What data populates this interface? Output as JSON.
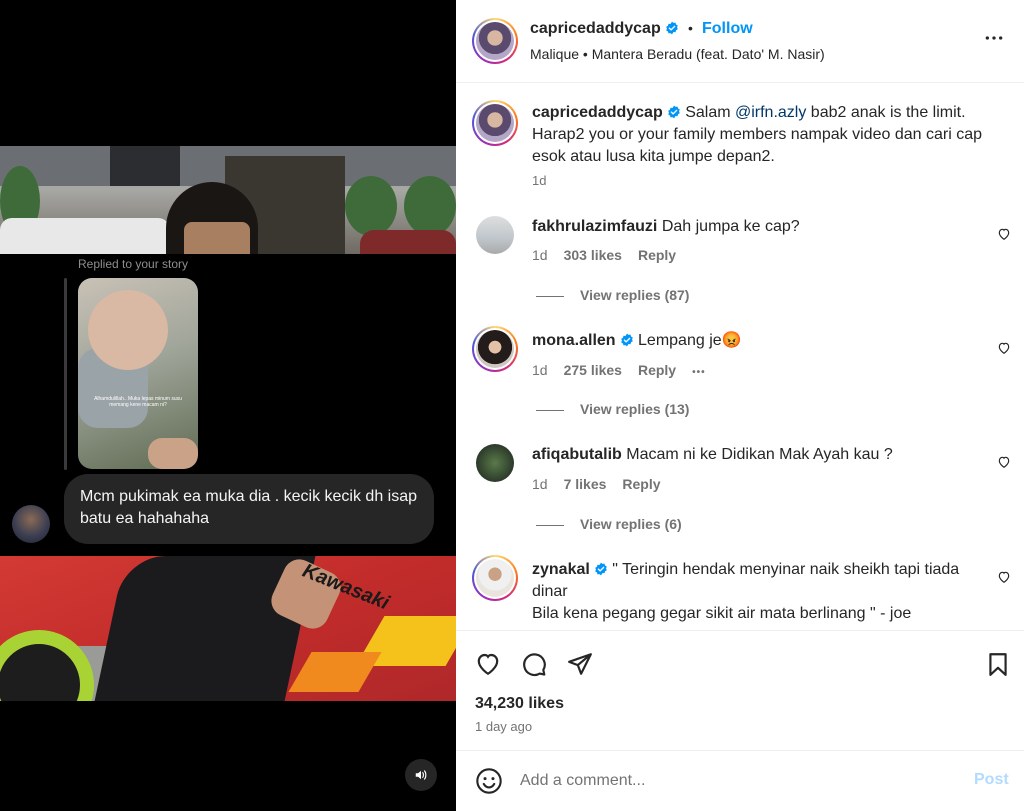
{
  "media": {
    "replied_label": "Replied to your story",
    "story_caption": "Alhamdulillah.. Muka lepas minum susu memang kene macam ni?",
    "message": "Mcm pukimak ea muka dia . kecik kecik dh isap batu ea hahahaha",
    "bike_brand": "Kawasaki"
  },
  "header": {
    "username": "capricedaddycap",
    "dot": "•",
    "follow": "Follow",
    "music": "Malique • Mantera Beradu (feat. Dato' M. Nasir)"
  },
  "caption": {
    "username": "capricedaddycap",
    "text_before": "Salam ",
    "mention": "@irfn.azly",
    "text_after": " bab2 anak is the limit. Harap2 you or your family members nampak video dan cari cap esok atau lusa kita jumpe depan2.",
    "time": "1d"
  },
  "comments": [
    {
      "username": "fakhrulazimfauzi",
      "text": "Dah jumpa ke cap?",
      "time": "1d",
      "likes": "303 likes",
      "reply": "Reply",
      "view_replies": "View replies (87)"
    },
    {
      "username": "mona.allen",
      "text": "Lempang je😡",
      "time": "1d",
      "likes": "275 likes",
      "reply": "Reply",
      "more": "•••",
      "view_replies": "View replies (13)"
    },
    {
      "username": "afiqabutalib",
      "text": "Macam ni ke Didikan Mak Ayah kau ?",
      "time": "1d",
      "likes": "7 likes",
      "reply": "Reply",
      "view_replies": "View replies (6)"
    },
    {
      "username": "zynakal",
      "text_line1": "\" Teringin hendak menyinar naik sheikh tapi tiada dinar",
      "text_line2": "Bila kena pegang gegar sikit air mata berlinang \" - joe"
    }
  ],
  "footer": {
    "likes": "34,230 likes",
    "ago": "1 day ago",
    "comment_placeholder": "Add a comment...",
    "post": "Post"
  },
  "colors": {
    "accent": "#0095f6",
    "verified": "#0095f6",
    "post_disabled": "#b3dbff"
  }
}
